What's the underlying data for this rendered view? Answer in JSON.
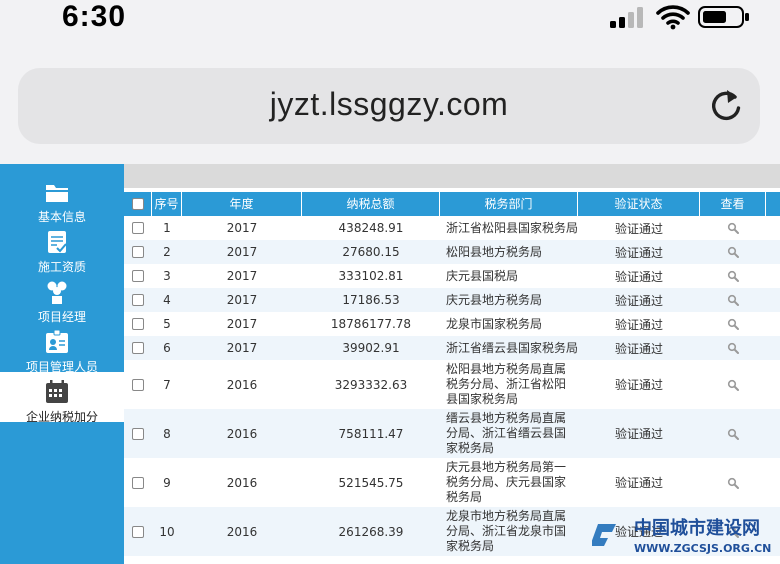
{
  "status": {
    "time": "6:30"
  },
  "browser": {
    "url": "jyzt.lssggzy.com"
  },
  "sidebar": {
    "items": [
      {
        "label": "基本信息",
        "icon": "folder-icon"
      },
      {
        "label": "施工资质",
        "icon": "clipboard-check-icon"
      },
      {
        "label": "项目经理",
        "icon": "people-icon"
      },
      {
        "label": "项目管理人员",
        "icon": "id-badge-icon"
      },
      {
        "label": "企业纳税加分",
        "icon": "calendar-icon"
      }
    ],
    "active_index": 4
  },
  "table": {
    "headers": {
      "seq": "序号",
      "year": "年度",
      "tax": "纳税总额",
      "dept": "税务部门",
      "status": "验证状态",
      "view": "查看"
    },
    "rows": [
      {
        "seq": "1",
        "year": "2017",
        "tax": "438248.91",
        "dept": "浙江省松阳县国家税务局",
        "status": "验证通过"
      },
      {
        "seq": "2",
        "year": "2017",
        "tax": "27680.15",
        "dept": "松阳县地方税务局",
        "status": "验证通过"
      },
      {
        "seq": "3",
        "year": "2017",
        "tax": "333102.81",
        "dept": "庆元县国税局",
        "status": "验证通过"
      },
      {
        "seq": "4",
        "year": "2017",
        "tax": "17186.53",
        "dept": "庆元县地方税务局",
        "status": "验证通过"
      },
      {
        "seq": "5",
        "year": "2017",
        "tax": "18786177.78",
        "dept": "龙泉市国家税务局",
        "status": "验证通过"
      },
      {
        "seq": "6",
        "year": "2017",
        "tax": "39902.91",
        "dept": "浙江省缙云县国家税务局",
        "status": "验证通过"
      },
      {
        "seq": "7",
        "year": "2016",
        "tax": "3293332.63",
        "dept": "松阳县地方税务局直属税务分局、浙江省松阳县国家税务局",
        "status": "验证通过"
      },
      {
        "seq": "8",
        "year": "2016",
        "tax": "758111.47",
        "dept": "缙云县地方税务局直属分局、浙江省缙云县国家税务局",
        "status": "验证通过"
      },
      {
        "seq": "9",
        "year": "2016",
        "tax": "521545.75",
        "dept": "庆元县地方税务局第一税务分局、庆元县国家税务局",
        "status": "验证通过"
      },
      {
        "seq": "10",
        "year": "2016",
        "tax": "261268.39",
        "dept": "龙泉市地方税务局直属分局、浙江省龙泉市国家税务局",
        "status": "验证通过"
      }
    ]
  },
  "watermark": {
    "title": "中国城市建设网",
    "url": "WWW.ZGCSJS.ORG.CN"
  },
  "colors": {
    "accent": "#2b9ad6",
    "row_alt": "#eef5fb"
  }
}
